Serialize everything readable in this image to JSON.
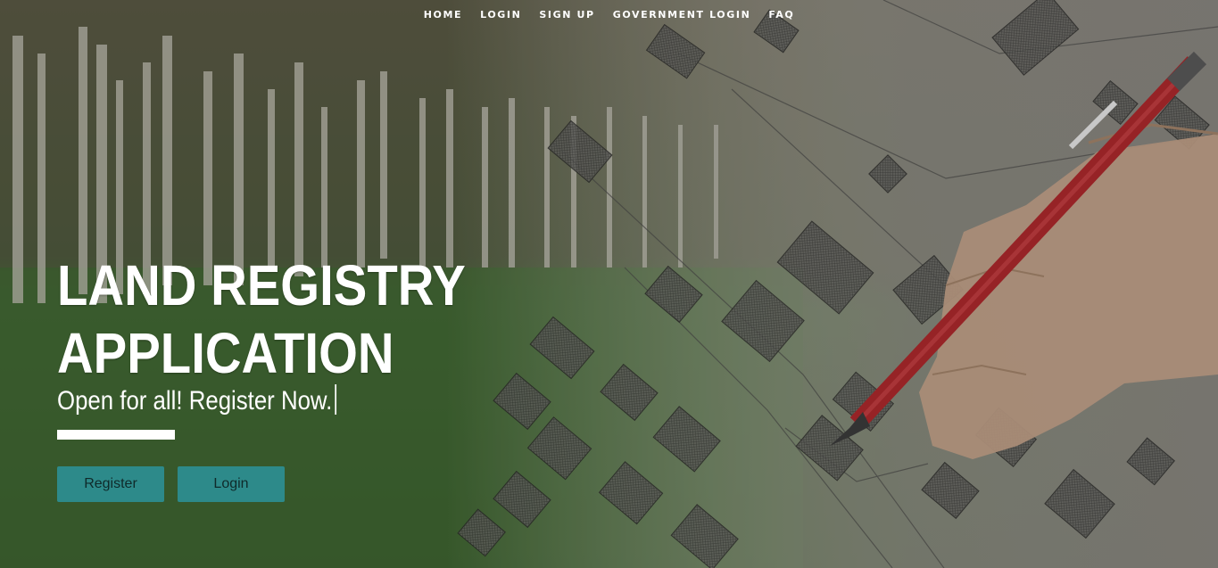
{
  "nav": {
    "items": [
      {
        "label": "HOME"
      },
      {
        "label": "LOGIN"
      },
      {
        "label": "SIGN UP"
      },
      {
        "label": "GOVERNMENT LOGIN"
      },
      {
        "label": "FAQ"
      }
    ]
  },
  "hero": {
    "title_line1": "LAND REGISTRY",
    "title_line2": "APPLICATION",
    "subtitle": "Open for all! Register Now.",
    "buttons": {
      "register": "Register",
      "login": "Login"
    }
  },
  "colors": {
    "button_bg": "#2d8a8a",
    "text": "#ffffff"
  }
}
